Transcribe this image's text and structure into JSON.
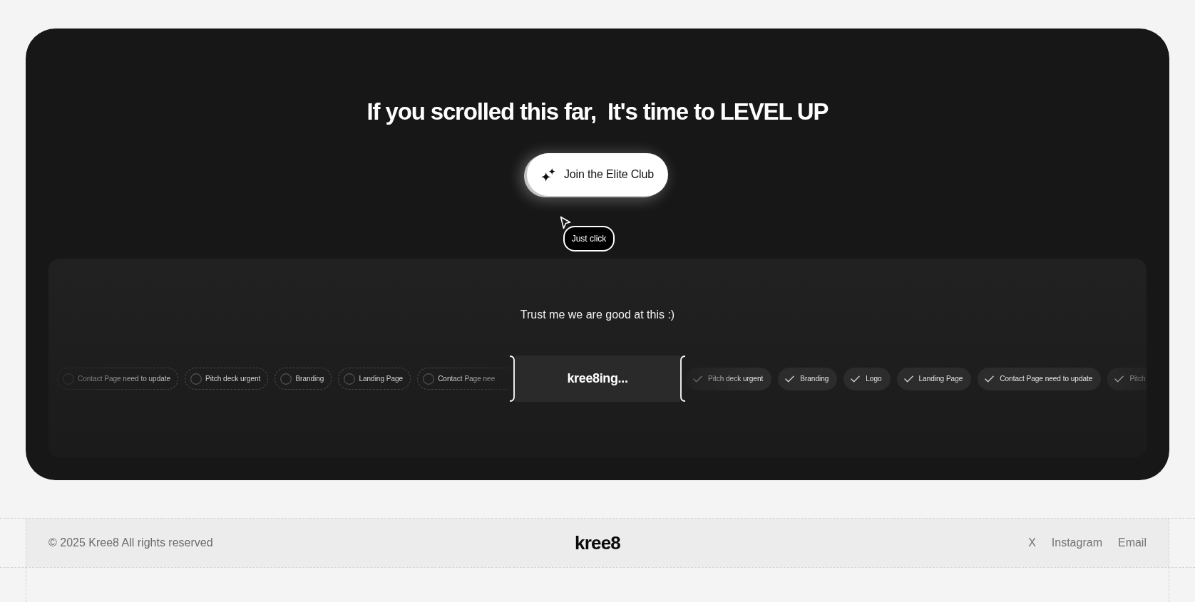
{
  "hero": {
    "heading": "If you scrolled this far,  It's time to LEVEL UP",
    "cta_button": {
      "label": "Join the Elite Club"
    },
    "cursor_label": "Just click"
  },
  "showcase": {
    "caption": "Trust me we are good at this :)",
    "status": "kree8ing...",
    "pending_tasks": [
      {
        "label": "Contact Page need to update",
        "checked": false
      },
      {
        "label": "Pitch deck urgent",
        "checked": false
      },
      {
        "label": "Branding",
        "checked": false
      },
      {
        "label": "Landing Page",
        "checked": false
      },
      {
        "label": "Contact Page nee",
        "checked": false
      }
    ],
    "done_tasks": [
      {
        "label": "Pitch deck urgent",
        "checked": true
      },
      {
        "label": "Branding",
        "checked": true
      },
      {
        "label": "Logo",
        "checked": true
      },
      {
        "label": "Landing Page",
        "checked": true
      },
      {
        "label": "Contact Page need to update",
        "checked": true
      },
      {
        "label": "Pitch",
        "checked": true
      }
    ]
  },
  "footer": {
    "copyright": "© 2025 Kree8 All rights reserved",
    "logo": "kree8",
    "links": [
      {
        "label": "X"
      },
      {
        "label": "Instagram"
      },
      {
        "label": "Email"
      }
    ]
  }
}
